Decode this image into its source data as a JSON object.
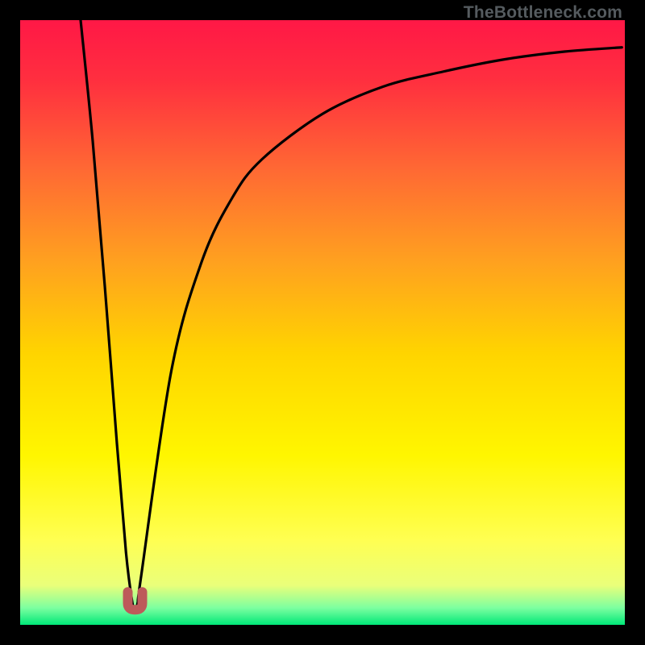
{
  "attribution": "TheBottleneck.com",
  "chart_data": {
    "type": "line",
    "title": "",
    "xlabel": "",
    "ylabel": "",
    "xlim": [
      0,
      100
    ],
    "ylim": [
      0,
      100
    ],
    "grid": false,
    "legend": false,
    "series": [
      {
        "name": "bottleneck-curve",
        "x": [
          10,
          12,
          14,
          16,
          17.5,
          18.5,
          19.0,
          19.5,
          20,
          25,
          30,
          35,
          40,
          50,
          60,
          70,
          80,
          90,
          99.5
        ],
        "values": [
          100,
          80,
          56,
          30,
          12,
          4,
          2.5,
          4,
          8,
          42,
          60,
          70.5,
          77,
          84.5,
          89,
          91.5,
          93.5,
          94.8,
          95.5
        ]
      }
    ],
    "markers": [
      {
        "name": "optimum-cap",
        "x": 19.0,
        "y": 2.5,
        "color": "#bd5a5a",
        "shape": "u-cap"
      }
    ],
    "gradient_stops": [
      {
        "offset": 0.0,
        "color": "#ff1846"
      },
      {
        "offset": 0.1,
        "color": "#ff2f3f"
      },
      {
        "offset": 0.25,
        "color": "#ff6a33"
      },
      {
        "offset": 0.4,
        "color": "#ffa11f"
      },
      {
        "offset": 0.55,
        "color": "#ffd400"
      },
      {
        "offset": 0.72,
        "color": "#fff600"
      },
      {
        "offset": 0.86,
        "color": "#ffff52"
      },
      {
        "offset": 0.935,
        "color": "#eaff7a"
      },
      {
        "offset": 0.972,
        "color": "#7cffa0"
      },
      {
        "offset": 1.0,
        "color": "#00e878"
      }
    ]
  }
}
